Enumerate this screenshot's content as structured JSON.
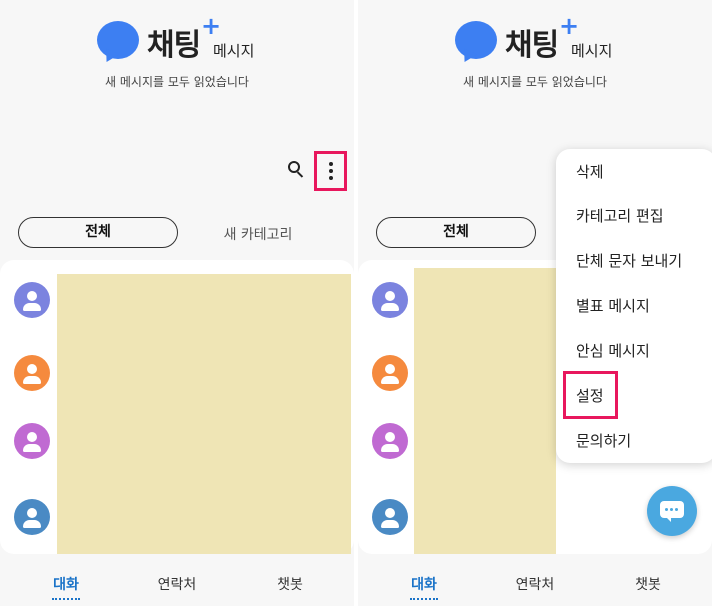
{
  "app": {
    "logo_main": "채팅",
    "logo_plus": "+",
    "logo_sub": "메시지",
    "status": "새 메시지를 모두 읽었습니다"
  },
  "toolbar": {
    "search_icon": "search-icon",
    "more_icon": "more-vertical-icon"
  },
  "tabs": {
    "all": "전체",
    "new_category": "새 카테고리"
  },
  "avatar_colors": [
    "#7b83df",
    "#f58a3e",
    "#c06ad2",
    "#4a8ac4"
  ],
  "bottom_nav": {
    "conversations": "대화",
    "contacts": "연락처",
    "chatbot": "챗봇"
  },
  "menu": {
    "items": [
      "삭제",
      "카테고리 편집",
      "단체 문자 보내기",
      "별표 메시지",
      "안심 메시지",
      "설정",
      "문의하기"
    ]
  },
  "colors": {
    "brand": "#3d7ff2",
    "highlight": "#e8175d",
    "active_tab": "#1a73c8",
    "fab": "#4aa8e0"
  }
}
